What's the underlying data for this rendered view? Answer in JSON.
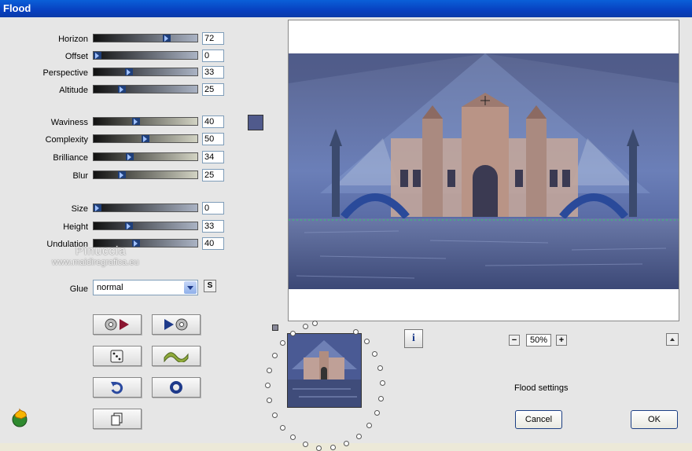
{
  "window": {
    "title": "Flood"
  },
  "sliders_group1": [
    {
      "label": "Horizon",
      "value": "72",
      "fraction": 0.72
    },
    {
      "label": "Offset",
      "value": "0",
      "fraction": 0.0
    },
    {
      "label": "Perspective",
      "value": "33",
      "fraction": 0.33
    },
    {
      "label": "Altitude",
      "value": "25",
      "fraction": 0.25
    }
  ],
  "sliders_group2": [
    {
      "label": "Waviness",
      "value": "40",
      "fraction": 0.4
    },
    {
      "label": "Complexity",
      "value": "50",
      "fraction": 0.5
    },
    {
      "label": "Brilliance",
      "value": "34",
      "fraction": 0.34
    },
    {
      "label": "Blur",
      "value": "25",
      "fraction": 0.25
    }
  ],
  "sliders_group3": [
    {
      "label": "Size",
      "value": "0",
      "fraction": 0.0
    },
    {
      "label": "Height",
      "value": "33",
      "fraction": 0.33
    },
    {
      "label": "Undulation",
      "value": "40",
      "fraction": 0.4
    }
  ],
  "color_swatch": "#505a8c",
  "watermark": {
    "name": "Pinuccia",
    "url": "www.maidiregrafica.eu"
  },
  "glue": {
    "label": "Glue",
    "value": "normal",
    "reset_label": "S"
  },
  "tool_buttons": [
    "load-preset-icon",
    "save-preset-icon",
    "random-dice-icon",
    "wave-icon",
    "undo-icon",
    "reset-ring-icon",
    "copy-icon"
  ],
  "preview": {
    "zoom": "50%"
  },
  "status": {
    "settings_text": "Flood settings"
  },
  "buttons": {
    "cancel": "Cancel",
    "ok": "OK"
  },
  "colors": {
    "accent": "#1c3f84",
    "title_bar": "#0840c0"
  }
}
